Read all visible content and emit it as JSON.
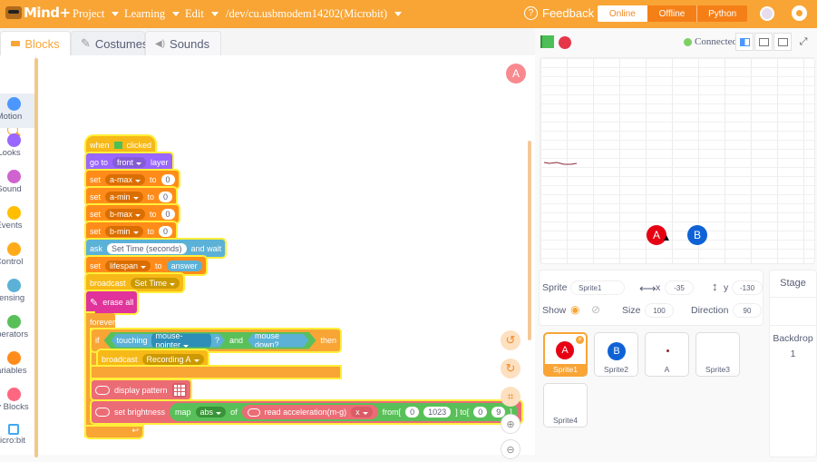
{
  "topbar": {
    "logo_text": "Mind+",
    "menus": [
      "Project",
      "Learning",
      "Edit",
      "/dev/cu.usbmodem14202(Microbit)"
    ],
    "feedback": "Feedback",
    "modes": [
      "Online",
      "Offline",
      "Python"
    ],
    "active_mode": "Online",
    "accent": "#f8a536"
  },
  "tabs": {
    "blocks": "Blocks",
    "costumes": "Costumes",
    "sounds": "Sounds"
  },
  "categories": [
    {
      "label": "Motion",
      "color": "#4c97ff"
    },
    {
      "label": "Looks",
      "color": "#9966ff"
    },
    {
      "label": "Sound",
      "color": "#cf63cf"
    },
    {
      "label": "Events",
      "color": "#ffbf00"
    },
    {
      "label": "Control",
      "color": "#ffab19"
    },
    {
      "label": "Sensing",
      "color": "#5cb1d6"
    },
    {
      "label": "Operators",
      "color": "#59c059"
    },
    {
      "label": "Variables",
      "color": "#ff8c1a"
    },
    {
      "label": "My Blocks",
      "color": "#ff6680"
    },
    {
      "label": "micro:bit",
      "color": "#3fa9f5"
    }
  ],
  "workspace": {
    "sprite_badge": "A",
    "script": {
      "when_clicked": [
        "when",
        "clicked"
      ],
      "goto": {
        "go": "go to",
        "opt": "front",
        "layer": "layer"
      },
      "sets": [
        {
          "set": "set",
          "var": "a-max",
          "to": "to",
          "val": "0"
        },
        {
          "set": "set",
          "var": "a-min",
          "to": "to",
          "val": "0"
        },
        {
          "set": "set",
          "var": "b-max",
          "to": "to",
          "val": "0"
        },
        {
          "set": "set",
          "var": "b-min",
          "to": "to",
          "val": "0"
        }
      ],
      "ask": {
        "ask": "ask",
        "q": "Set Time (seconds)",
        "wait": "and wait"
      },
      "set_lifespan": {
        "set": "set",
        "var": "lifespan",
        "to": "to",
        "val": "answer"
      },
      "broadcast1": {
        "label": "broadcast",
        "msg": "Set Time"
      },
      "erase": "erase all",
      "forever": "forever",
      "if": {
        "if": "if",
        "touching": "touching",
        "target": "mouse-pointer",
        "q": "?",
        "and": "and",
        "mouse": "mouse down?",
        "then": "then"
      },
      "broadcast2": {
        "label": "broadcast",
        "msg": "Recording A"
      },
      "display": "display pattern",
      "brightness": {
        "label": "set brightness",
        "map": "map",
        "fn": "abs",
        "of": "of",
        "read": "read acceleration(m-g)",
        "axis": "x",
        "from": "from[",
        "f0": "0",
        "f1": "1023",
        "to": "] to[",
        "t0": "0",
        "t1": "9",
        "end": "]"
      }
    }
  },
  "stage_header": {
    "connected": "Connected"
  },
  "stage": {
    "sprites": [
      {
        "label": "A",
        "color": "#e60012"
      },
      {
        "label": "B",
        "color": "#0f62d6"
      }
    ]
  },
  "sprite_info": {
    "sprite_label": "Sprite",
    "sprite_name": "Sprite1",
    "x_label": "x",
    "x": "-35",
    "y_label": "y",
    "y": "-130",
    "show_label": "Show",
    "size_label": "Size",
    "size": "100",
    "direction_label": "Direction",
    "direction": "90"
  },
  "sprites": [
    {
      "name": "Sprite1",
      "icon": "A",
      "selected": true
    },
    {
      "name": "Sprite2",
      "icon": "B"
    },
    {
      "name": "A",
      "icon": "dot"
    },
    {
      "name": "Sprite3",
      "icon": ""
    },
    {
      "name": "Sprite4",
      "icon": ""
    }
  ],
  "stage_panel": {
    "title": "Stage",
    "backdrop_label": "Backdrop",
    "backdrop_count": "1"
  }
}
